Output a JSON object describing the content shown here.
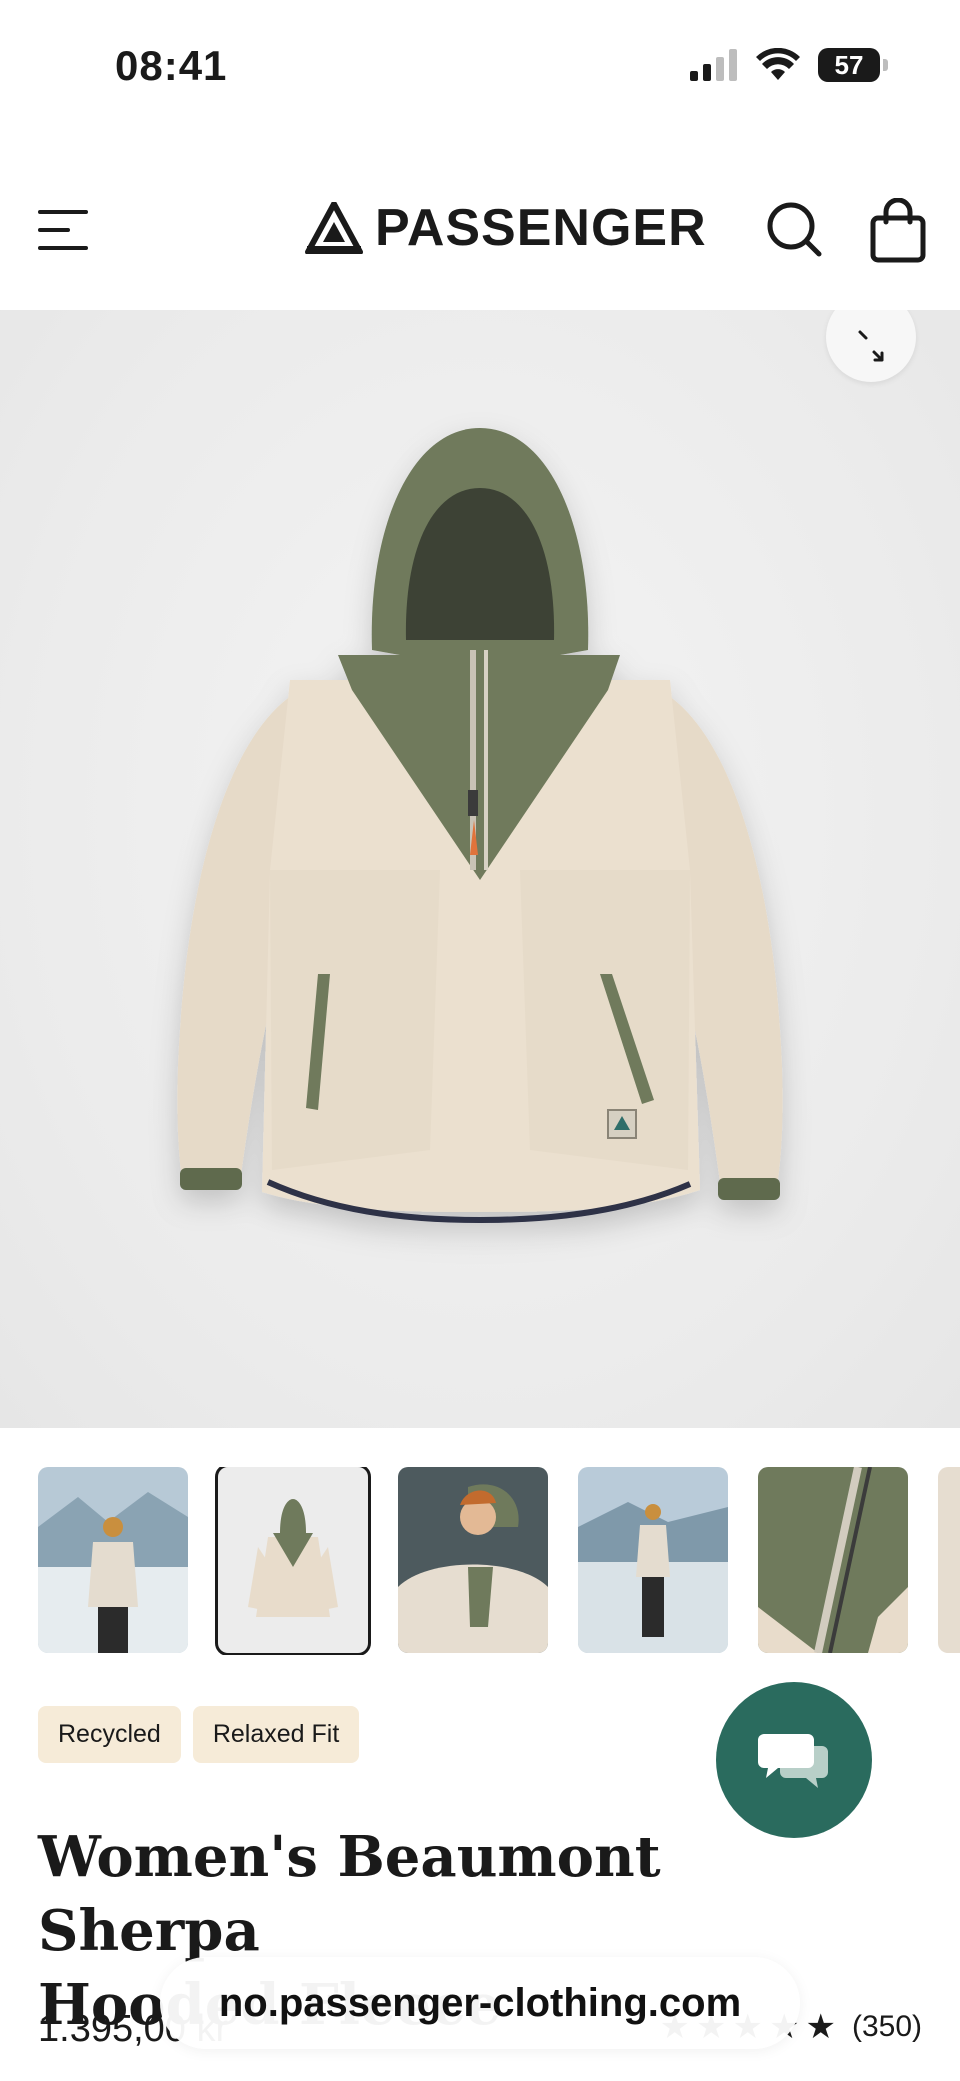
{
  "status_bar": {
    "time": "08:41",
    "battery": "57"
  },
  "header": {
    "brand": "PASSENGER"
  },
  "product": {
    "tags": [
      "Recycled",
      "Relaxed Fit"
    ],
    "title_line1": "Women's Beaumont Sherpa",
    "title_line2": "Hooded Fleece",
    "price": "1.395,00 kr",
    "rating": 5,
    "review_count": "(350)"
  },
  "browser": {
    "url": "no.passenger-clothing.com"
  },
  "colors": {
    "chat_button": "#2a6b5e",
    "tag_bg": "#f6ebd8",
    "jacket_fleece": "#e8dccb",
    "jacket_olive": "#6f7a5c"
  },
  "icons": [
    "menu-icon",
    "logo-mountain-icon",
    "search-icon",
    "shopping-bag-icon",
    "expand-icon",
    "chat-icon",
    "star-icon"
  ]
}
